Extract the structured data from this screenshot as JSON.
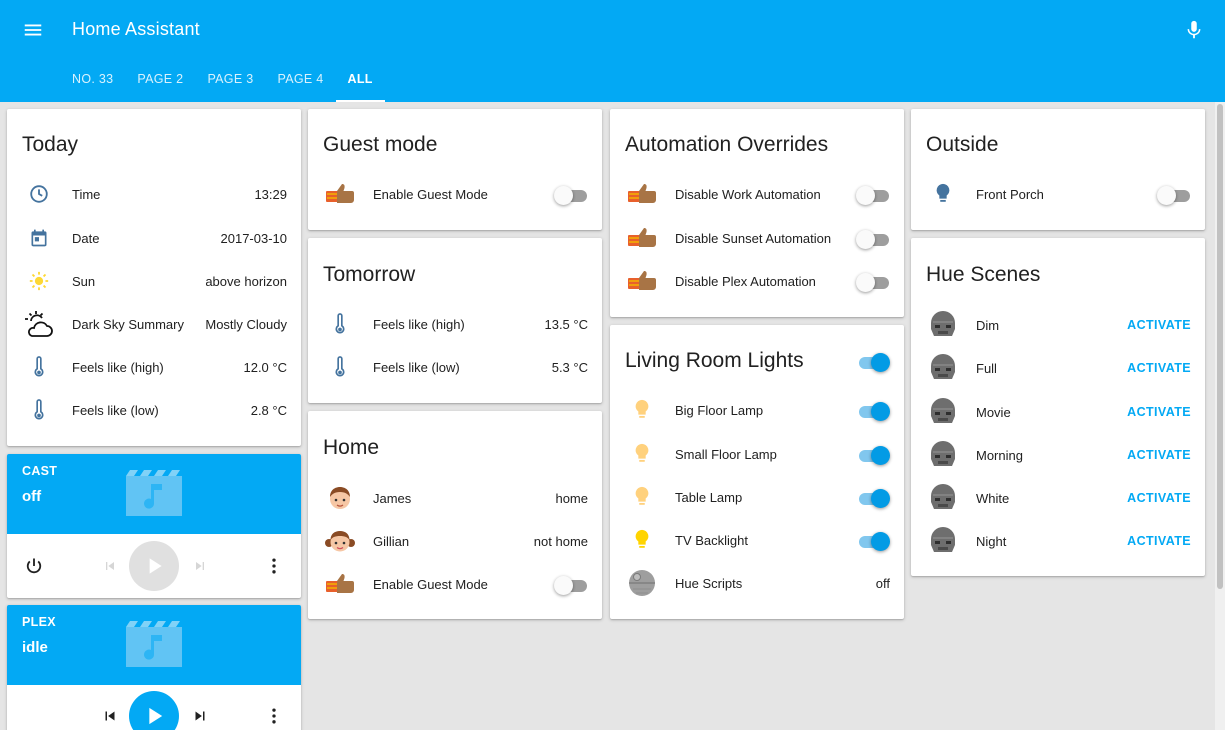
{
  "header": {
    "title": "Home Assistant",
    "menu_icon": "menu-icon",
    "mic_icon": "microphone-icon",
    "accent": "#03a9f4"
  },
  "tabs": [
    {
      "label": "NO. 33"
    },
    {
      "label": "PAGE 2"
    },
    {
      "label": "PAGE 3"
    },
    {
      "label": "PAGE 4"
    },
    {
      "label": "ALL",
      "active": true
    }
  ],
  "today": {
    "title": "Today",
    "rows": [
      {
        "icon": "clock-icon",
        "name": "Time",
        "state": "13:29"
      },
      {
        "icon": "calendar-icon",
        "name": "Date",
        "state": "2017-03-10"
      },
      {
        "icon": "sun-icon",
        "name": "Sun",
        "state": "above horizon"
      },
      {
        "icon": "partly-cloudy-icon",
        "name": "Dark Sky Summary",
        "state": "Mostly Cloudy"
      },
      {
        "icon": "thermometer-icon",
        "name": "Feels like (high)",
        "state": "12.0 °C"
      },
      {
        "icon": "thermometer-icon",
        "name": "Feels like (low)",
        "state": "2.8 °C"
      }
    ]
  },
  "cast": {
    "name": "CAST",
    "state": "off"
  },
  "plex": {
    "name": "PLEX",
    "state": "idle"
  },
  "guest_mode": {
    "title": "Guest mode",
    "rows": [
      {
        "icon": "thumbs-up-icon",
        "name": "Enable Guest Mode",
        "on": false
      }
    ]
  },
  "tomorrow": {
    "title": "Tomorrow",
    "rows": [
      {
        "icon": "thermometer-icon",
        "name": "Feels like (high)",
        "state": "13.5 °C"
      },
      {
        "icon": "thermometer-icon",
        "name": "Feels like (low)",
        "state": "5.3 °C"
      }
    ]
  },
  "home": {
    "title": "Home",
    "rows": [
      {
        "icon": "avatar-james-icon",
        "name": "James",
        "state": "home"
      },
      {
        "icon": "avatar-gillian-icon",
        "name": "Gillian",
        "state": "not home"
      },
      {
        "icon": "thumbs-up-icon",
        "name": "Enable Guest Mode",
        "on": false
      }
    ]
  },
  "automation": {
    "title": "Automation Overrides",
    "rows": [
      {
        "icon": "thumbs-up-icon",
        "name": "Disable Work Automation",
        "on": false
      },
      {
        "icon": "thumbs-up-icon",
        "name": "Disable Sunset Automation",
        "on": false
      },
      {
        "icon": "thumbs-up-icon",
        "name": "Disable Plex Automation",
        "on": false
      }
    ]
  },
  "living_room": {
    "title": "Living Room Lights",
    "group_on": true,
    "rows": [
      {
        "icon": "lightbulb-icon",
        "name": "Big Floor Lamp",
        "on": true
      },
      {
        "icon": "lightbulb-icon",
        "name": "Small Floor Lamp",
        "on": true
      },
      {
        "icon": "lightbulb-icon",
        "name": "Table Lamp",
        "on": true
      },
      {
        "icon": "lightbulb-icon",
        "name": "TV Backlight",
        "on": true
      },
      {
        "icon": "death-star-icon",
        "name": "Hue Scripts",
        "state": "off"
      }
    ]
  },
  "outside": {
    "title": "Outside",
    "rows": [
      {
        "icon": "lightbulb-icon",
        "name": "Front Porch",
        "on": false
      }
    ]
  },
  "hue_scenes": {
    "title": "Hue Scenes",
    "action_label": "ACTIVATE",
    "rows": [
      {
        "icon": "helmet-icon",
        "name": "Dim"
      },
      {
        "icon": "helmet-icon",
        "name": "Full"
      },
      {
        "icon": "helmet-icon",
        "name": "Movie"
      },
      {
        "icon": "helmet-icon",
        "name": "Morning"
      },
      {
        "icon": "helmet-icon",
        "name": "White"
      },
      {
        "icon": "helmet-icon",
        "name": "Night"
      }
    ]
  }
}
